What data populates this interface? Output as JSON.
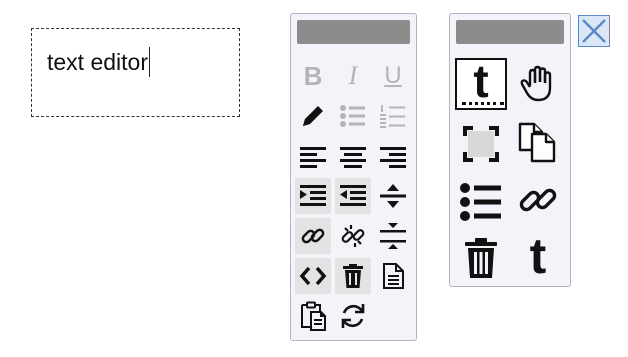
{
  "editor": {
    "text": "text editor"
  },
  "left_toolbar": {
    "buttons": [
      {
        "name": "bold",
        "icon": "bold-icon",
        "glyph": "B",
        "enabled": false
      },
      {
        "name": "italic",
        "icon": "italic-icon",
        "glyph": "I",
        "enabled": false
      },
      {
        "name": "underline",
        "icon": "underline-icon",
        "glyph": "U",
        "enabled": false
      },
      {
        "name": "pencil",
        "icon": "pencil-icon",
        "enabled": true
      },
      {
        "name": "bullet-list",
        "icon": "bullet-list-icon",
        "enabled": false
      },
      {
        "name": "numbered-list",
        "icon": "numbered-list-icon",
        "enabled": false
      },
      {
        "name": "align-left",
        "icon": "align-left-icon",
        "enabled": true
      },
      {
        "name": "align-center",
        "icon": "align-center-icon",
        "enabled": true
      },
      {
        "name": "align-right",
        "icon": "align-right-icon",
        "enabled": true
      },
      {
        "name": "indent",
        "icon": "indent-icon",
        "enabled": true
      },
      {
        "name": "outdent",
        "icon": "outdent-icon",
        "enabled": true
      },
      {
        "name": "expand-spacing",
        "icon": "expand-spacing-icon",
        "enabled": true
      },
      {
        "name": "link",
        "icon": "link-icon",
        "enabled": true
      },
      {
        "name": "unlink",
        "icon": "unlink-icon",
        "enabled": true
      },
      {
        "name": "collapse-spacing",
        "icon": "collapse-spacing-icon",
        "enabled": true
      },
      {
        "name": "code",
        "icon": "code-icon",
        "enabled": true
      },
      {
        "name": "delete",
        "icon": "trash-icon",
        "enabled": true
      },
      {
        "name": "document",
        "icon": "document-icon",
        "enabled": true
      },
      {
        "name": "paste",
        "icon": "paste-icon",
        "enabled": true
      },
      {
        "name": "refresh",
        "icon": "refresh-icon",
        "enabled": true
      }
    ]
  },
  "right_toolbar": {
    "buttons": [
      {
        "name": "text-tool",
        "icon": "text-tool-icon",
        "glyph": "t",
        "selected": true
      },
      {
        "name": "pan-tool",
        "icon": "hand-icon"
      },
      {
        "name": "select-frame",
        "icon": "frame-icon"
      },
      {
        "name": "duplicate",
        "icon": "copy-icon"
      },
      {
        "name": "list",
        "icon": "list-icon"
      },
      {
        "name": "link",
        "icon": "link-icon"
      },
      {
        "name": "delete",
        "icon": "trash-icon"
      },
      {
        "name": "text-block",
        "icon": "text-icon",
        "glyph": "t"
      }
    ]
  },
  "colors": {
    "panel_bg": "#f3f3fa",
    "handle": "#8c8c8c",
    "disabled": "#b5b5b5",
    "close_border": "#5b89c8"
  }
}
